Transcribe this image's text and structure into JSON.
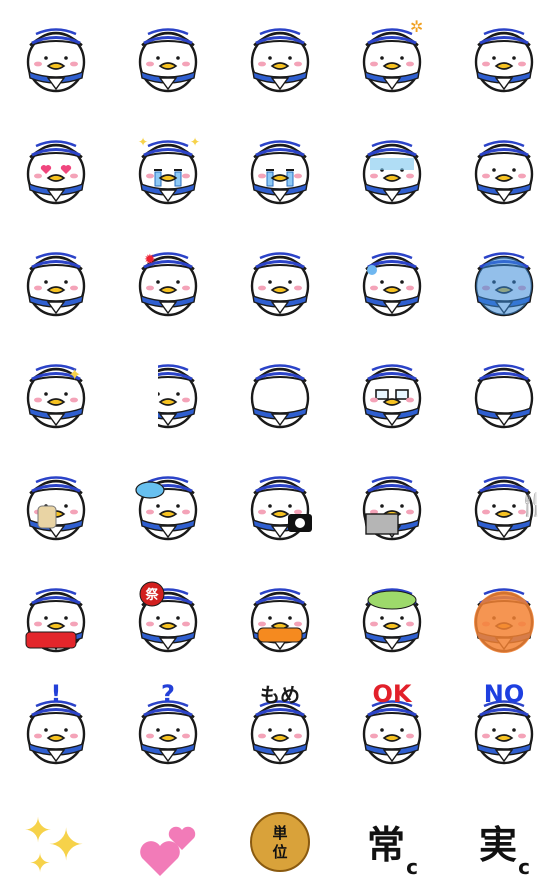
{
  "sheet": {
    "rows": [
      [
        {
          "kind": "duck",
          "mood": "smile"
        },
        {
          "kind": "duck",
          "mood": "salute"
        },
        {
          "kind": "duck",
          "mood": "thinking"
        },
        {
          "kind": "duck",
          "mood": "angry-mark"
        },
        {
          "kind": "duck",
          "mood": "shocked"
        }
      ],
      [
        {
          "kind": "duck",
          "mood": "heart-eyes"
        },
        {
          "kind": "duck",
          "mood": "crying-joy"
        },
        {
          "kind": "duck",
          "mood": "crying"
        },
        {
          "kind": "duck",
          "mood": "gloom"
        },
        {
          "kind": "duck",
          "mood": "hat-off"
        }
      ],
      [
        {
          "kind": "duck",
          "mood": "dash"
        },
        {
          "kind": "duck",
          "mood": "annoyed"
        },
        {
          "kind": "duck",
          "mood": "sad-tear"
        },
        {
          "kind": "duck",
          "mood": "sweat"
        },
        {
          "kind": "duck",
          "mood": "blue-shock"
        }
      ],
      [
        {
          "kind": "duck",
          "mood": "sparkle-thumb"
        },
        {
          "kind": "duck",
          "mood": "peek"
        },
        {
          "kind": "duck",
          "mood": "back-view"
        },
        {
          "kind": "duck",
          "mood": "glasses"
        },
        {
          "kind": "duck",
          "mood": "top-view"
        }
      ],
      [
        {
          "kind": "duck",
          "mood": "hug-bear"
        },
        {
          "kind": "duck",
          "mood": "fan"
        },
        {
          "kind": "duck",
          "mood": "camera"
        },
        {
          "kind": "duck",
          "mood": "laptop"
        },
        {
          "kind": "duck",
          "mood": "fork-knife"
        }
      ],
      [
        {
          "kind": "duck",
          "mood": "car"
        },
        {
          "kind": "duck",
          "mood": "festival"
        },
        {
          "kind": "duck",
          "mood": "orange-bib"
        },
        {
          "kind": "duck",
          "mood": "green-cap"
        },
        {
          "kind": "duck",
          "mood": "octopus"
        }
      ],
      [
        {
          "kind": "duck",
          "mood": "exclaim",
          "caption": "!"
        },
        {
          "kind": "duck",
          "mood": "question",
          "caption": "?"
        },
        {
          "kind": "duck",
          "mood": "mome",
          "caption": "もめ"
        },
        {
          "kind": "duck",
          "mood": "ok",
          "caption": "OK"
        },
        {
          "kind": "duck",
          "mood": "no",
          "caption": "NO"
        }
      ],
      [
        {
          "kind": "sparkles"
        },
        {
          "kind": "hearts"
        },
        {
          "kind": "coin",
          "caption": "単位"
        },
        {
          "kind": "kanji",
          "caption": "常",
          "sub": "c"
        },
        {
          "kind": "kanji",
          "caption": "実",
          "sub": "c"
        }
      ]
    ]
  },
  "special_text": {
    "matsuri": "祭"
  },
  "colors": {
    "hat_blue": "#2b43c8",
    "scarf_blue": "#2f5fd0",
    "beak": "#f7c322",
    "blush": "#f4a3b8",
    "outline": "#1a1a1a",
    "exclaim_blue": "#2340d8",
    "ok_red": "#e2202a",
    "no_blue": "#1e3fe0",
    "coin": "#d9a23a",
    "sparkle": "#f6d24a",
    "heart_pink": "#f27bb8"
  }
}
